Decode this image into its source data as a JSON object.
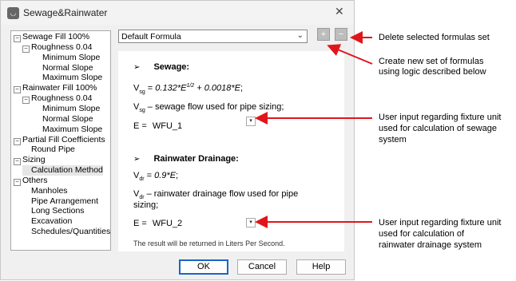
{
  "window": {
    "title": "Sewage&Rainwater",
    "close_glyph": "✕"
  },
  "tree": [
    {
      "label": "Sewage Fill 100%",
      "level": 0,
      "toggle": "−"
    },
    {
      "label": "Roughness 0.04",
      "level": 1,
      "toggle": "−"
    },
    {
      "label": "Minimum Slope",
      "level": 2
    },
    {
      "label": "Normal Slope",
      "level": 2
    },
    {
      "label": "Maximum Slope",
      "level": 2
    },
    {
      "label": "Rainwater Fill 100%",
      "level": 0,
      "toggle": "−"
    },
    {
      "label": "Roughness 0.04",
      "level": 1,
      "toggle": "−"
    },
    {
      "label": "Minimum Slope",
      "level": 2
    },
    {
      "label": "Normal Slope",
      "level": 2
    },
    {
      "label": "Maximum Slope",
      "level": 2
    },
    {
      "label": "Partial Fill Coefficients",
      "level": 0,
      "toggle": "−"
    },
    {
      "label": "Round Pipe",
      "level": 1
    },
    {
      "label": "Sizing",
      "level": 0,
      "toggle": "−"
    },
    {
      "label": "Calculation Method",
      "level": 1,
      "selected": true
    },
    {
      "label": "Others",
      "level": 0,
      "toggle": "−"
    },
    {
      "label": "Manholes",
      "level": 1
    },
    {
      "label": "Pipe Arrangement",
      "level": 1
    },
    {
      "label": "Long Sections",
      "level": 1
    },
    {
      "label": "Excavation",
      "level": 1
    },
    {
      "label": "Schedules/Quantities",
      "level": 1
    }
  ],
  "formula_set": {
    "selected": "Default Formula",
    "add_glyph": "+",
    "delete_glyph": "−"
  },
  "sewage": {
    "bullet": "➢",
    "heading": "Sewage:",
    "formula_lhs": "V",
    "formula_lhs_sub": "sg",
    "formula_eq": " = ",
    "formula_rhs_a": "0.132*E",
    "formula_rhs_sup": "1/2",
    "formula_rhs_b": " + 0.0018*E",
    "formula_end": ";",
    "desc_v": "V",
    "desc_sub": "sg",
    "desc_text": " – sewage flow used for pipe sizing;",
    "input_label": "E =",
    "input_value": "WFU_1"
  },
  "rainwater": {
    "bullet": "➢",
    "heading": "Rainwater Drainage:",
    "formula_lhs": "V",
    "formula_lhs_sub": "dr",
    "formula_eq": " = ",
    "formula_rhs": "0.9*E",
    "formula_end": ";",
    "desc_v": "V",
    "desc_sub": "dr",
    "desc_text_1": " – rainwater drainage flow used for pipe",
    "desc_text_2": "sizing;",
    "input_label": "E =",
    "input_value": "WFU_2"
  },
  "note": "The result will be returned in Liters Per Second.",
  "buttons": {
    "ok": "OK",
    "cancel": "Cancel",
    "help": "Help"
  },
  "annotations": {
    "delete": "Delete selected formulas  set",
    "create_1": "Create new set of formulas",
    "create_2": "using logic described below",
    "sewage_1": "User input  regarding fixture unit",
    "sewage_2": "used for calculation of sewage",
    "sewage_3": "system",
    "rain_1": "User input  regarding fixture unit",
    "rain_2": "used for calculation of",
    "rain_3": "rainwater drainage system"
  },
  "colors": {
    "arrow": "#e0161b",
    "ok_border": "#1a64c9"
  }
}
